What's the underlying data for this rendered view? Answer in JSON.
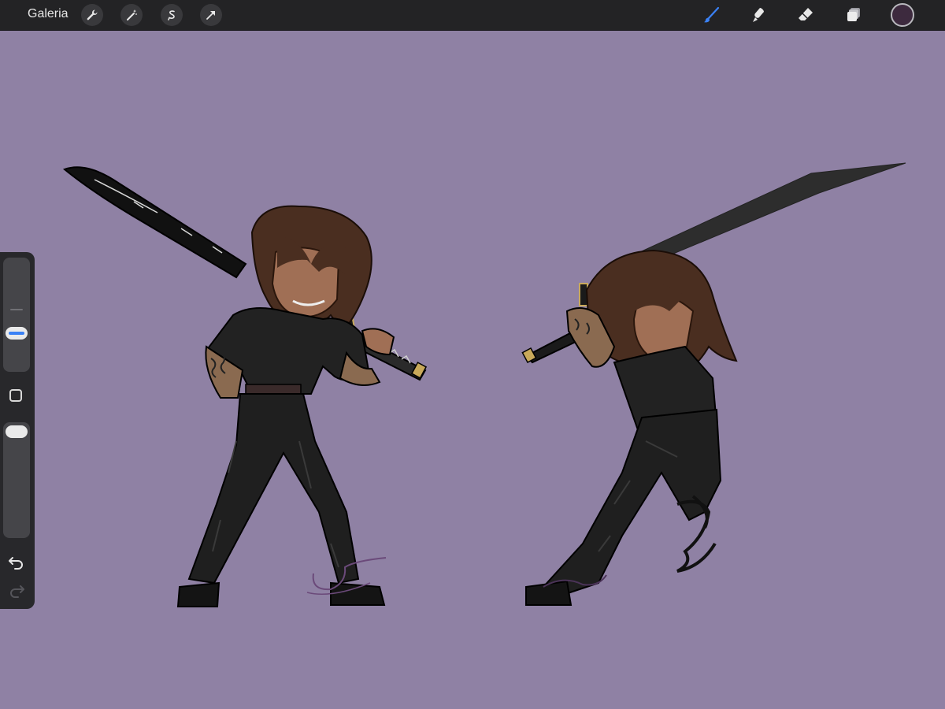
{
  "topbar": {
    "gallery_label": "Galeria",
    "left_tools": [
      "wrench-icon",
      "magic-wand-icon",
      "selection-icon",
      "transform-arrow-icon"
    ],
    "right_tools": [
      "brush-icon",
      "smudge-icon",
      "eraser-icon",
      "layers-icon"
    ],
    "active_tool": "brush-icon",
    "current_color": "#3d2a3e",
    "accent": "#3b82f6"
  },
  "canvas": {
    "background": "#8f81a4"
  },
  "sidebar": {
    "controls": [
      "brush-size-slider",
      "modify-button",
      "opacity-slider",
      "undo-icon",
      "redo-icon"
    ],
    "redo_enabled": false
  }
}
